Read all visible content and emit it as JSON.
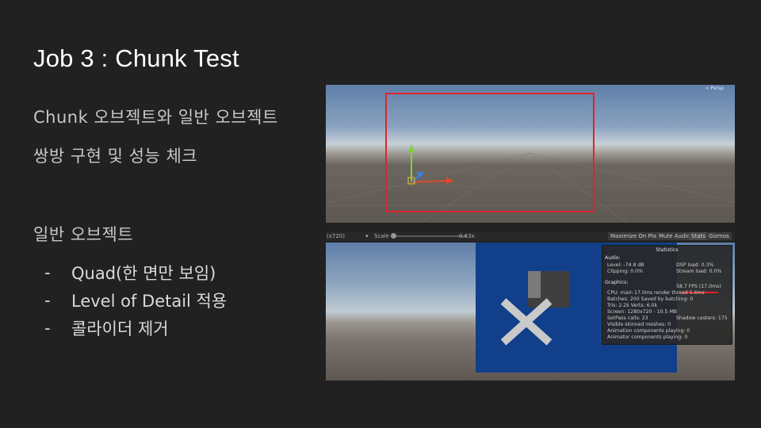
{
  "slide": {
    "title": "Job 3 : Chunk Test",
    "intro_line1": "Chunk 오브젝트와 일반 오브젝트",
    "intro_line2": "쌍방 구현 및 성능 체크",
    "section": "일반 오브젝트",
    "bullets": [
      {
        "dash": "-",
        "text": "Quad(한 면만 보임)"
      },
      {
        "dash": "-",
        "text": "Level of Detail 적용"
      },
      {
        "dash": "-",
        "text": "콜라이더 제거"
      }
    ]
  },
  "scene_view": {
    "persp_label": "< Persp"
  },
  "game_toolbar": {
    "resolution": "(x720)",
    "scale_label": "Scale",
    "scale_value": "0.63x",
    "maximize": "Maximize On Play",
    "mute": "Mute Audio",
    "stats": "Stats",
    "gizmos": "Gizmos"
  },
  "stats_panel": {
    "title": "Statistics",
    "audio_header": "Audio:",
    "level": "Level: -74.8 dB",
    "clipping": "Clipping: 0.0%",
    "dsp": "DSP load: 0.3%",
    "stream": "Stream load: 0.0%",
    "graphics_header": "Graphics:",
    "fps": "58.7 FPS (17.0ms)",
    "cpu": "CPU: main 17.0ms  render thread 5.6ms",
    "batches": "Batches: 200   Saved by batching: 0",
    "tris": "Tris: 2.2k       Verts: 6.0k",
    "screen": "Screen: 1280x720 - 10.5 MB",
    "setpass": "SetPass calls: 23",
    "shadow": "Shadow casters: 175",
    "skinned": "Visible skinned meshes: 0",
    "anim": "Animation components playing: 0",
    "animator": "Animator components playing: 0"
  },
  "colors": {
    "highlight": "#e0242a",
    "quad_blue": "#113f8a"
  }
}
